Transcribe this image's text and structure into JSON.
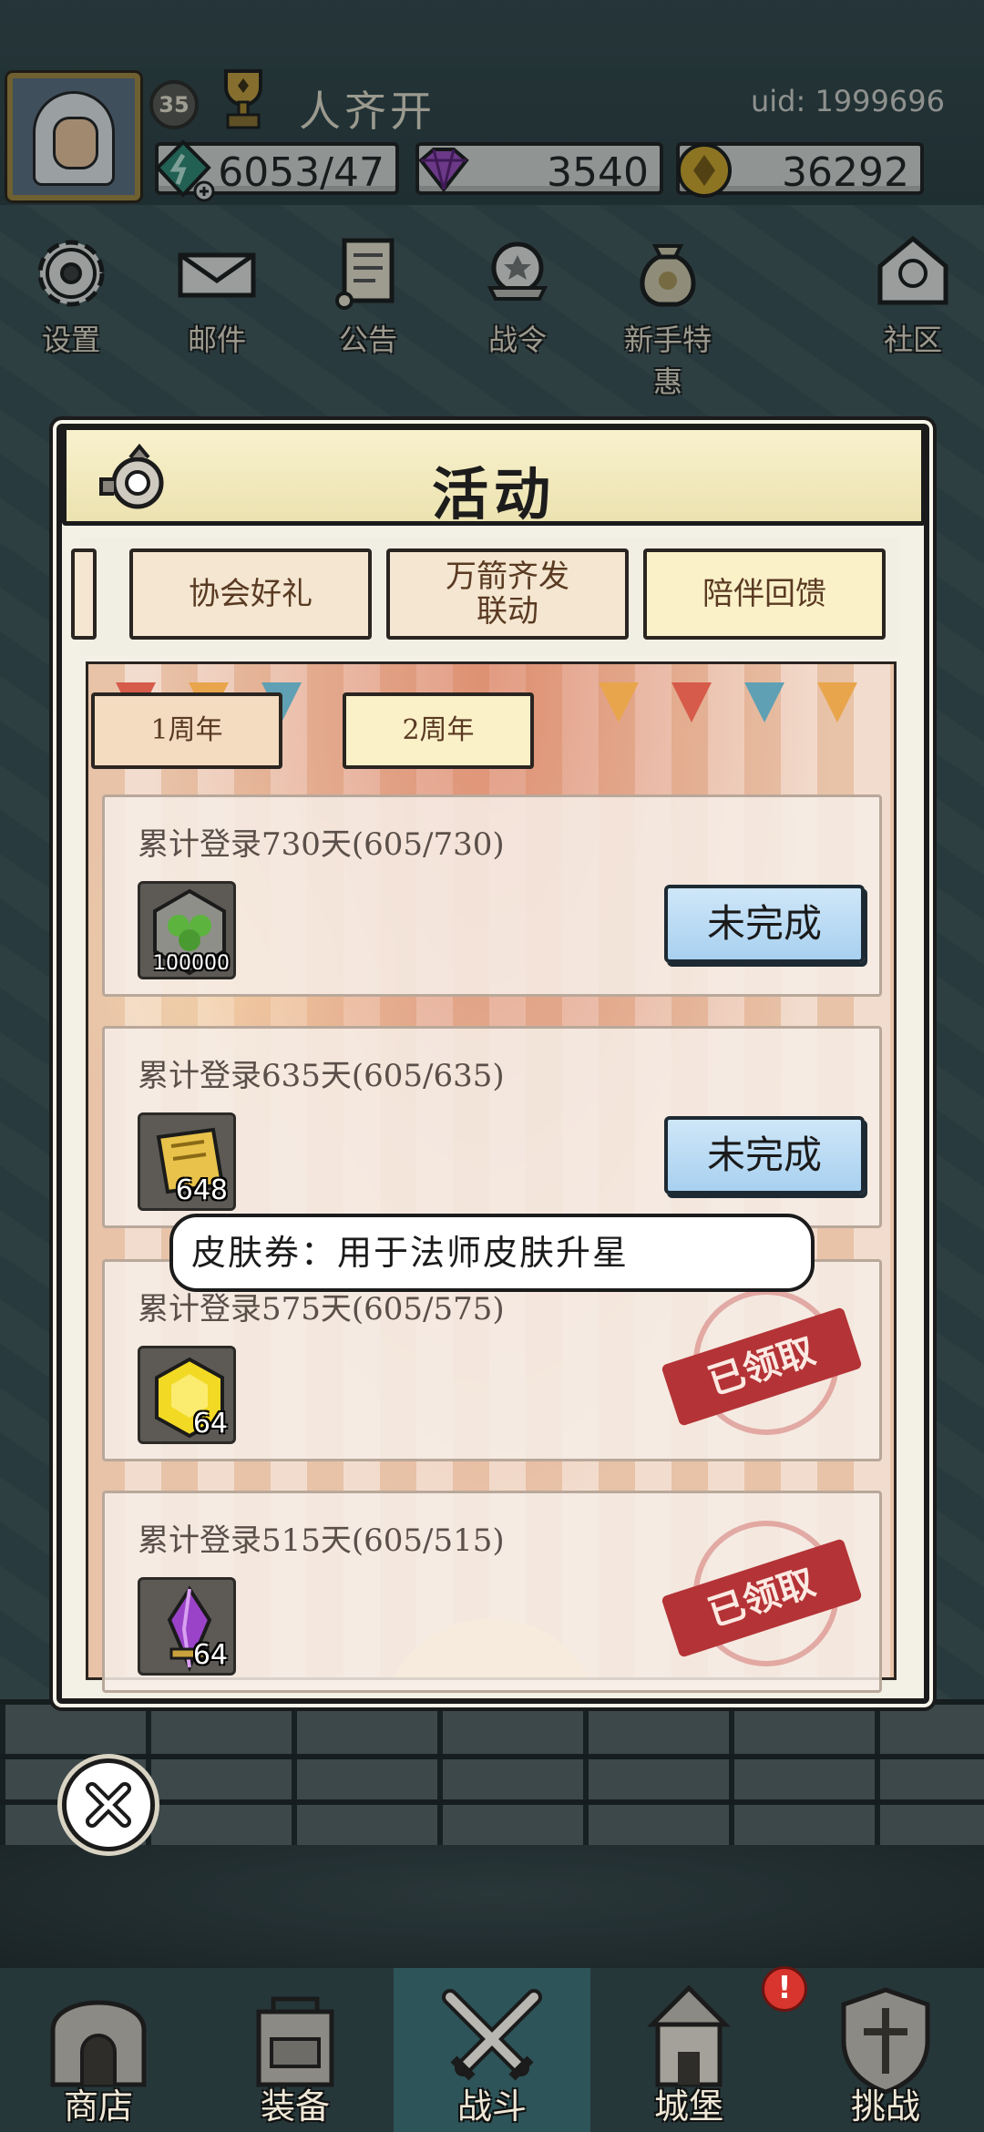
{
  "header": {
    "level": "35",
    "player_name": "人齐开",
    "uid": "uid: 1999696",
    "resources": {
      "energy": "6053/47",
      "gems": "3540",
      "gold": "36292"
    }
  },
  "menu": [
    {
      "label": "设置",
      "icon": "gear-icon"
    },
    {
      "label": "邮件",
      "icon": "mail-icon"
    },
    {
      "label": "公告",
      "icon": "scroll-icon"
    },
    {
      "label": "战令",
      "icon": "battle-pass-icon"
    },
    {
      "label": "新手特惠",
      "icon": "money-bag-icon"
    },
    {
      "label": "社区",
      "icon": "community-icon"
    }
  ],
  "modal": {
    "title": "活动",
    "tabs": [
      {
        "label": "协会好礼"
      },
      {
        "label": "万箭齐发\n联动"
      },
      {
        "label": "陪伴回馈",
        "active": true
      }
    ],
    "subtabs": [
      {
        "label": "1周年"
      },
      {
        "label": "2周年",
        "active": true
      }
    ],
    "rows": [
      {
        "title": "累计登录730天(605/730)",
        "reward_qty": "100000",
        "reward_icon": "clover-badge-icon",
        "status": "未完成",
        "claimed": false
      },
      {
        "title": "累计登录635天(605/635)",
        "reward_qty": "648",
        "reward_icon": "skin-ticket-icon",
        "status": "未完成",
        "claimed": false
      },
      {
        "title": "累计登录575天(605/575)",
        "reward_qty": "64",
        "reward_icon": "yellow-crystal-icon",
        "status": "已领取",
        "claimed": true
      },
      {
        "title": "累计登录515天(605/515)",
        "reward_qty": "64",
        "reward_icon": "purple-crystal-icon",
        "status": "已领取",
        "claimed": true
      }
    ],
    "tooltip": "皮肤券：用于法师皮肤升星"
  },
  "bottom_nav": [
    {
      "label": "商店",
      "icon": "shop-icon"
    },
    {
      "label": "装备",
      "icon": "backpack-icon"
    },
    {
      "label": "战斗",
      "icon": "crossed-swords-icon",
      "active": true
    },
    {
      "label": "城堡",
      "icon": "castle-icon",
      "alert": "!"
    },
    {
      "label": "挑战",
      "icon": "shield-icon"
    }
  ],
  "colors": {
    "claimed_stamp": "#b43336",
    "status_button": "#a8d1f0",
    "active_tab": "#fbf1c9"
  }
}
